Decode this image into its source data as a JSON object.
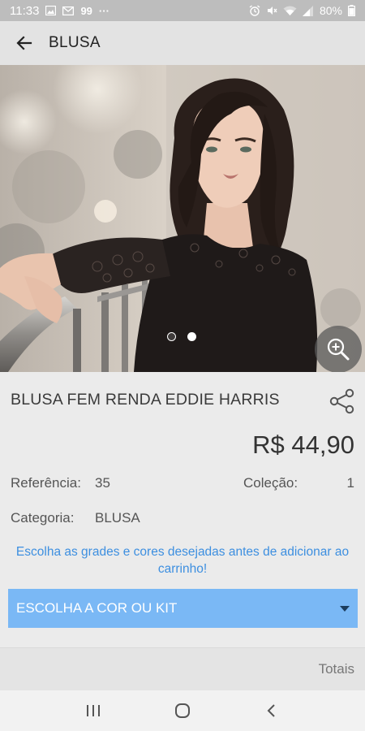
{
  "status_bar": {
    "time": "11:33",
    "notif_badge": "99",
    "more": "···",
    "battery": "80%",
    "icons": [
      "image-icon",
      "mail-icon",
      "alarm-icon",
      "mute-icon",
      "wifi-icon",
      "signal-icon",
      "battery-icon"
    ]
  },
  "app_bar": {
    "title": "BLUSA",
    "back_icon": "arrow-left-icon"
  },
  "gallery": {
    "image_count": 2,
    "active_index": 1,
    "zoom_icon": "zoom-in-icon"
  },
  "product": {
    "name": "BLUSA FEM RENDA EDDIE HARRIS",
    "price": "R$ 44,90",
    "share_icon": "share-icon",
    "reference_label": "Referência:",
    "reference_value": "35",
    "collection_label": "Coleção:",
    "collection_value": "1",
    "category_label": "Categoria:",
    "category_value": "BLUSA",
    "notice": "Escolha as grades e cores desejadas antes de adicionar ao carrinho!",
    "color_select_label": "ESCOLHA A COR  OU KIT",
    "totals_label": "Totais"
  },
  "colors": {
    "accent_blue": "#3d8fe0",
    "select_bg": "#7ab8f5",
    "status_bar": "#bdbdbd",
    "app_bar": "#e3e3e3",
    "background": "#ebebeb"
  }
}
